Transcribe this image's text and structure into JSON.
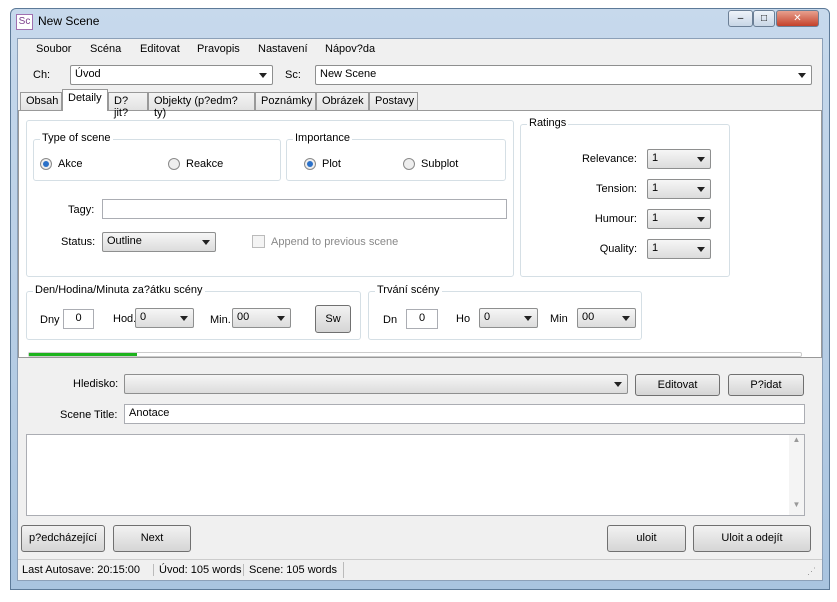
{
  "window": {
    "title": "New Scene",
    "icon_text": "Sc",
    "min": "–",
    "max": "□",
    "close": "✕"
  },
  "menu": [
    "Soubor",
    "Scéna",
    "Editovat",
    "Pravopis",
    "Nastavení",
    "Nápov?da"
  ],
  "ch_label": "Ch:",
  "ch_value": "Úvod",
  "sc_label": "Sc:",
  "sc_value": "New Scene",
  "tabs": [
    "Obsah",
    "Detaily",
    "D?jit?",
    "Objekty (p?edm?ty)",
    "Poznámky",
    "Obrázek",
    "Postavy"
  ],
  "active_tab": "Detaily",
  "type_of_scene": {
    "title": "Type of scene",
    "options": [
      "Akce",
      "Reakce"
    ],
    "selected": "Akce"
  },
  "importance": {
    "title": "Importance",
    "options": [
      "Plot",
      "Subplot"
    ],
    "selected": "Plot"
  },
  "tagy_label": "Tagy:",
  "tagy_value": "",
  "status_label": "Status:",
  "status_value": "Outline",
  "append_label": "Append to previous scene",
  "append_checked": false,
  "ratings": {
    "title": "Ratings",
    "items": [
      {
        "label": "Relevance:",
        "value": "1"
      },
      {
        "label": "Tension:",
        "value": "1"
      },
      {
        "label": "Humour:",
        "value": "1"
      },
      {
        "label": "Quality:",
        "value": "1"
      }
    ]
  },
  "start": {
    "title": "Den/Hodina/Minuta za?átku scény",
    "dny_label": "Dny",
    "dny": "0",
    "hod_label": "Hod.",
    "hod": "0",
    "min_label": "Min.",
    "min": "00",
    "sw": "Sw"
  },
  "duration": {
    "title": "Trvání scény",
    "dn_label": "Dn",
    "dn": "0",
    "ho_label": "Ho",
    "ho": "0",
    "min_label": "Min",
    "min": "00"
  },
  "progress_percent": 14,
  "progress_color": "#1db31d",
  "hledisko_label": "Hledisko:",
  "hledisko_value": "",
  "edit_button": "Editovat",
  "add_button": "P?idat",
  "scene_title_label": "Scene Title:",
  "scene_title_value": "Anotace",
  "buttons": {
    "prev": "p?edcházející",
    "next": "Next",
    "save": "uloit",
    "save_close": "Uloit a odejít"
  },
  "status": [
    "Last Autosave: 20:15:00",
    "Úvod: 105 words",
    "Scene: 105 words"
  ]
}
